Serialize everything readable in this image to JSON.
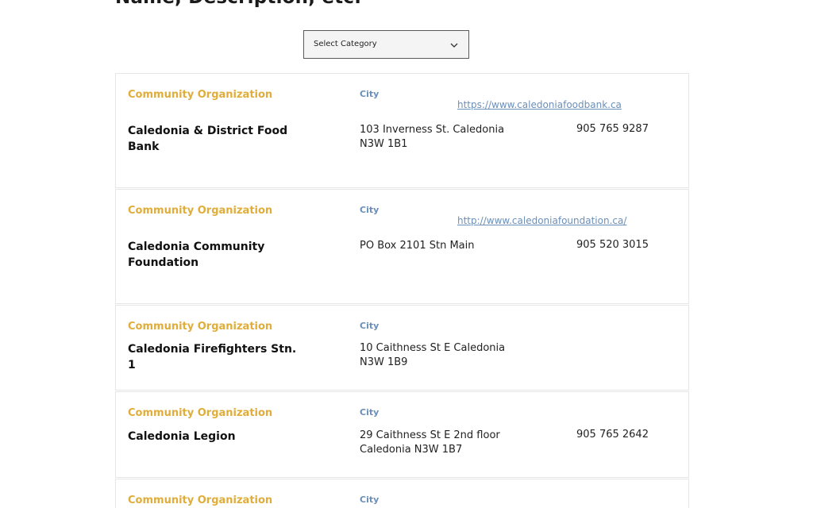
{
  "heading": "Name, Description, etc.",
  "filter": {
    "selected": "Select Category",
    "icon": "chevron-down-icon"
  },
  "colors": {
    "category": "#e0ad3a",
    "city": "#6b8fb8",
    "link": "#6b8fb8"
  },
  "listings": [
    {
      "category": "Community Organization",
      "city_label": "City",
      "website": "https://www.caledoniafoodbank.ca",
      "name": "Caledonia & District Food Bank",
      "address": "103 Inverness St. Caledonia N3W 1B1",
      "phone": "905 765 9287"
    },
    {
      "category": "Community Organization",
      "city_label": "City",
      "website": "http://www.caledoniafoundation.ca/",
      "name": "Caledonia Community Foundation",
      "address": "PO Box 2101 Stn Main",
      "phone": "905 520 3015"
    },
    {
      "category": "Community Organization",
      "city_label": "City",
      "name": "Caledonia Firefighters Stn. 1",
      "address": "10 Caithness St E Caledonia N3W 1B9"
    },
    {
      "category": "Community Organization",
      "city_label": "City",
      "name": "Caledonia Legion",
      "address": "29 Caithness St E 2nd floor Caledonia N3W 1B7",
      "phone": "905 765 2642"
    },
    {
      "category": "Community Organization",
      "city_label": "City"
    }
  ]
}
